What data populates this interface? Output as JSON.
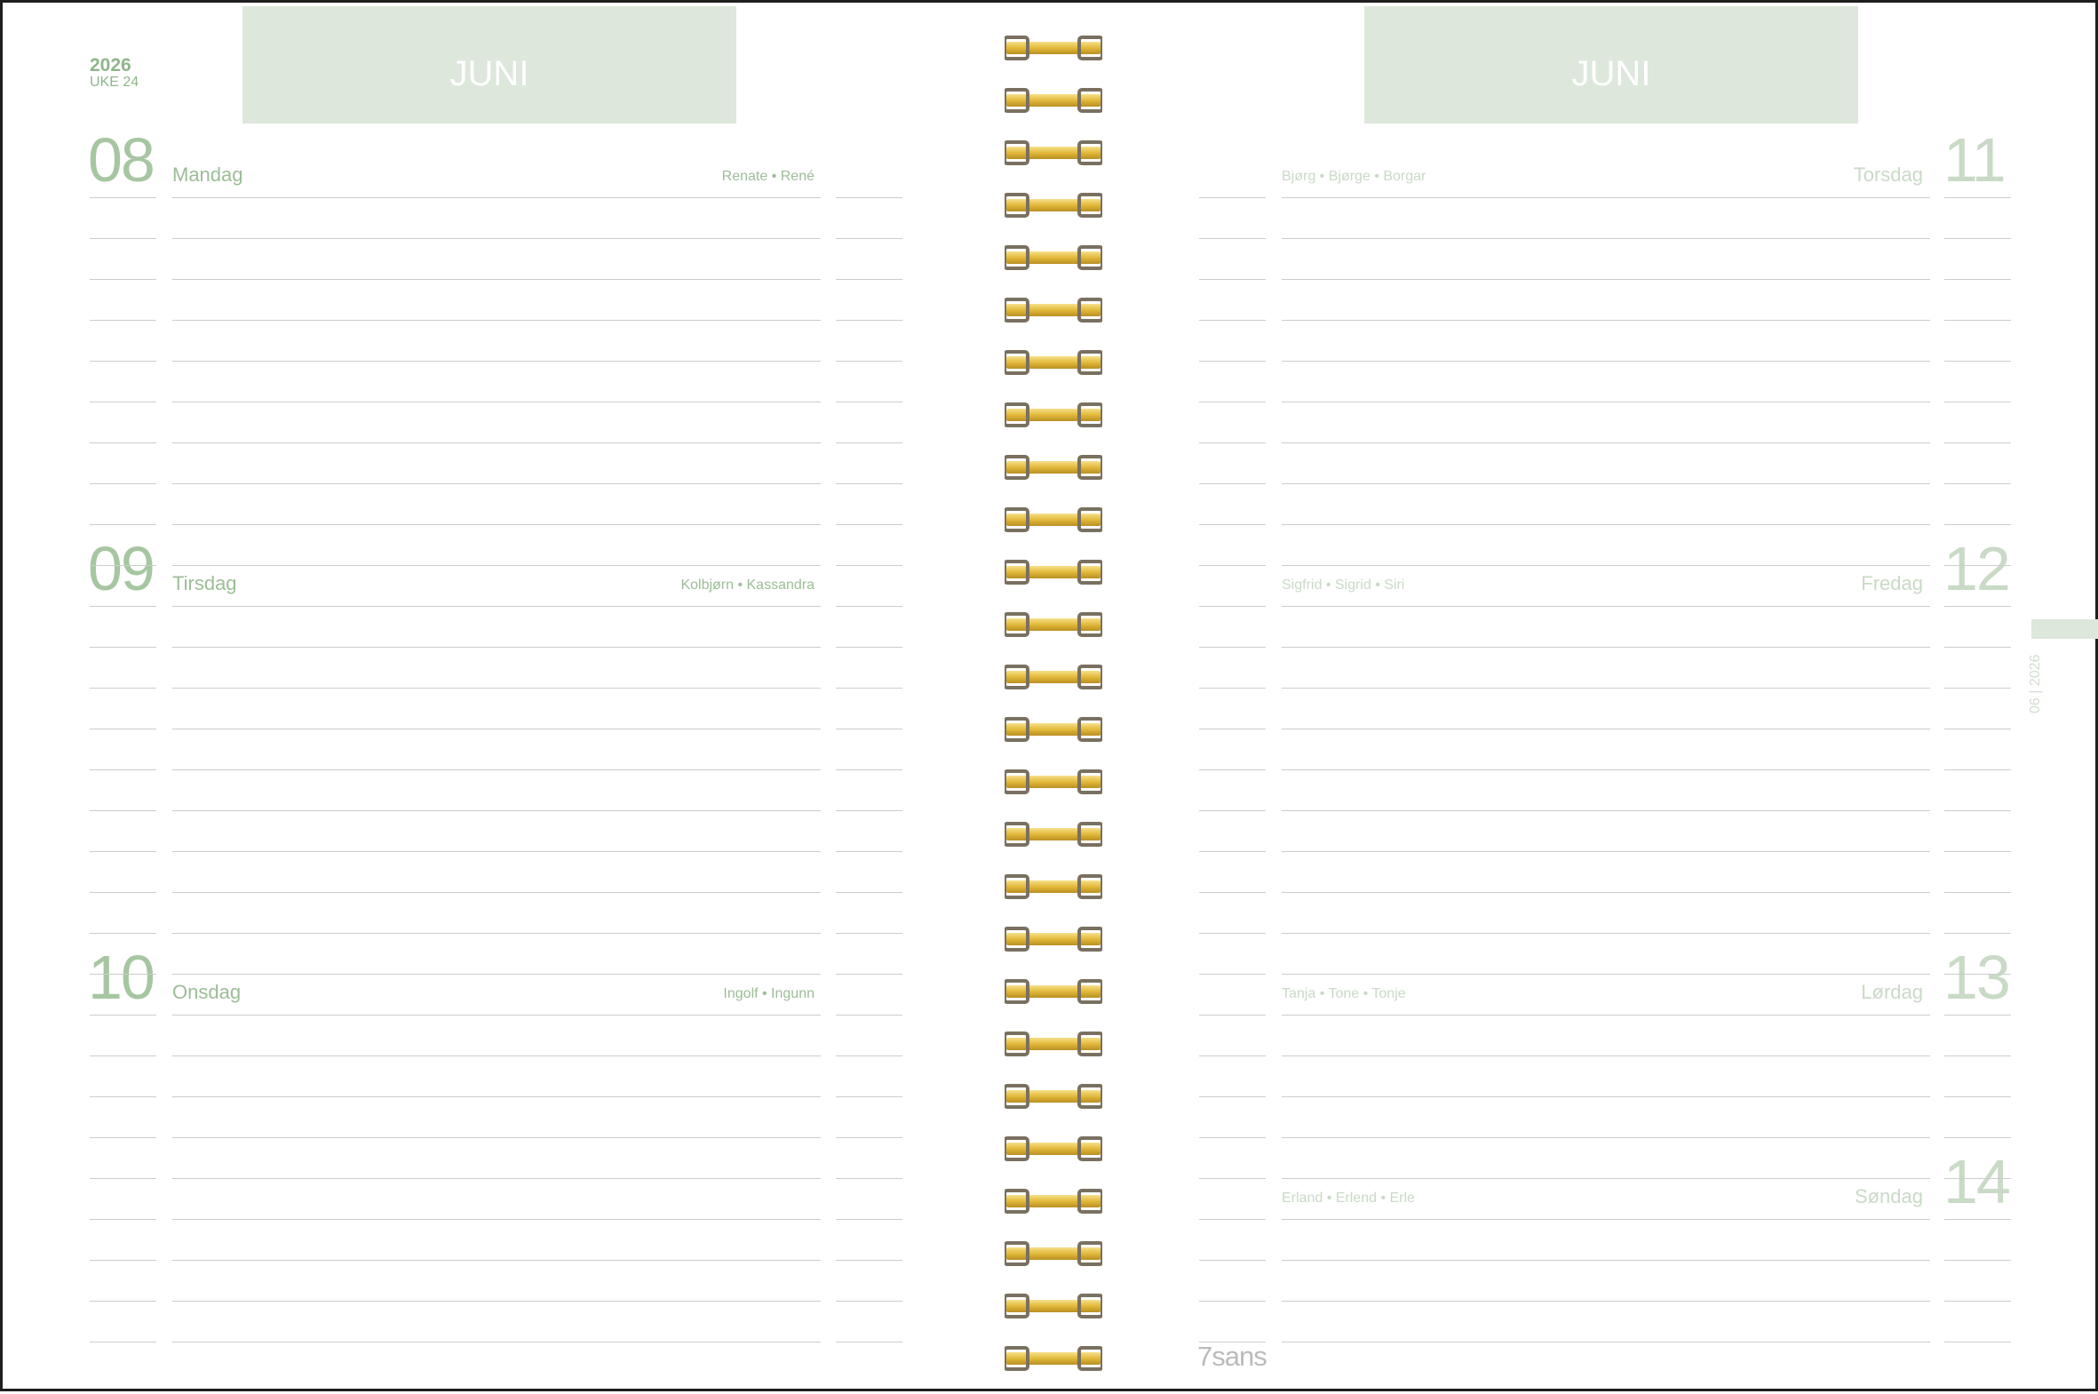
{
  "left_page": {
    "year": "2026",
    "week": "UKE 24",
    "month": "JUNI",
    "days": [
      {
        "number": "08",
        "weekday": "Mandag",
        "names": "Renate • René"
      },
      {
        "number": "09",
        "weekday": "Tirsdag",
        "names": "Kolbjørn • Kassandra"
      },
      {
        "number": "10",
        "weekday": "Onsdag",
        "names": "Ingolf • Ingunn"
      }
    ]
  },
  "right_page": {
    "month": "JUNI",
    "days": [
      {
        "number": "11",
        "weekday": "Torsdag",
        "names": "Bjørg • Bjørge • Borgar"
      },
      {
        "number": "12",
        "weekday": "Fredag",
        "names": "Sigfrid • Sigrid • Siri"
      },
      {
        "number": "13",
        "weekday": "Lørdag",
        "names": "Tanja • Tone • Tonje"
      },
      {
        "number": "14",
        "weekday": "Søndag",
        "names": "Erland • Erlend • Erle"
      }
    ],
    "side_tab_label": "06 | 2026",
    "brand": "7sans"
  },
  "colors": {
    "banner": "#dde7dc",
    "accent_green": "#a6c6a1",
    "pale_green": "#c9dac6",
    "rule": "#c9cec9",
    "wire_gold": "#e8c34a",
    "wire_bronze": "#7a7060"
  }
}
